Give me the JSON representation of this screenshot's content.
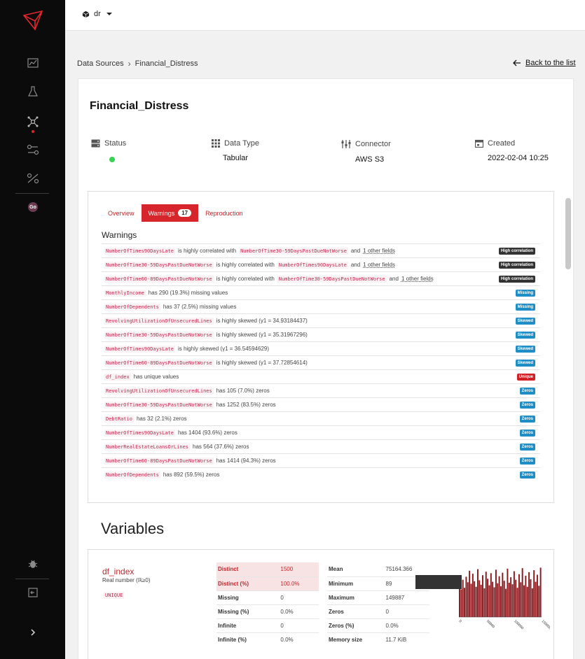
{
  "topbar": {
    "project": "dr"
  },
  "breadcrumb": {
    "parent": "Data Sources",
    "current": "Financial_Distress",
    "back": "Back to the list"
  },
  "dataset": {
    "title": "Financial_Distress",
    "meta": [
      {
        "label": "Status",
        "value": "",
        "icon": "server-icon"
      },
      {
        "label": "Data Type",
        "value": "Tabular",
        "icon": "grid-icon"
      },
      {
        "label": "Connector",
        "value": "AWS S3",
        "icon": "connector-icon"
      },
      {
        "label": "Created",
        "value": "2022-02-04 10:25",
        "icon": "calendar-icon"
      }
    ],
    "status_color": "#39d353"
  },
  "report": {
    "tabs": [
      {
        "label": "Overview"
      },
      {
        "label": "Warnings",
        "count": "17"
      },
      {
        "label": "Reproduction"
      }
    ],
    "warnings_heading": "Warnings",
    "warnings": [
      {
        "field": "NumberOfTimes90DaysLate",
        "text": "is highly correlated with",
        "field2": "NumberOfTime30-59DaysPastDueNotWorse",
        "tail": "and",
        "link": "1 other fields",
        "badge": "High correlation",
        "kind": "corr"
      },
      {
        "field": "NumberOfTime30-59DaysPastDueNotWorse",
        "text": "is highly correlated with",
        "field2": "NumberOfTimes90DaysLate",
        "tail": "and",
        "link": "1 other fields",
        "badge": "High correlation",
        "kind": "corr"
      },
      {
        "field": "NumberOfTime60-89DaysPastDueNotWorse",
        "text": "is highly correlated with",
        "field2": "NumberOfTime30-59DaysPastDueNotWorse",
        "tail": "and",
        "link": "1 other fields",
        "badge": "High correlation",
        "kind": "corr"
      },
      {
        "field": "MonthlyIncome",
        "text": "has 290 (19.3%) missing values",
        "badge": "Missing",
        "kind": "miss"
      },
      {
        "field": "NumberOfDependents",
        "text": "has 37 (2.5%) missing values",
        "badge": "Missing",
        "kind": "miss"
      },
      {
        "field": "RevolvingUtilizationOfUnsecuredLines",
        "text": "is highly skewed (γ1 = 34.93184437)",
        "badge": "Skewed",
        "kind": "skew"
      },
      {
        "field": "NumberOfTime30-59DaysPastDueNotWorse",
        "text": "is highly skewed (γ1 = 35.31967296)",
        "badge": "Skewed",
        "kind": "skew"
      },
      {
        "field": "NumberOfTimes90DaysLate",
        "text": "is highly skewed (γ1 = 36.54594629)",
        "badge": "Skewed",
        "kind": "skew"
      },
      {
        "field": "NumberOfTime60-89DaysPastDueNotWorse",
        "text": "is highly skewed (γ1 = 37.72854614)",
        "badge": "Skewed",
        "kind": "skew"
      },
      {
        "field": "df_index",
        "text": "has unique values",
        "badge": "Unique",
        "kind": "uniq"
      },
      {
        "field": "RevolvingUtilizationOfUnsecuredLines",
        "text": "has 105 (7.0%) zeros",
        "badge": "Zeros",
        "kind": "zero"
      },
      {
        "field": "NumberOfTime30-59DaysPastDueNotWorse",
        "text": "has 1252 (83.5%) zeros",
        "badge": "Zeros",
        "kind": "zero"
      },
      {
        "field": "DebtRatio",
        "text": "has 32 (2.1%) zeros",
        "badge": "Zeros",
        "kind": "zero"
      },
      {
        "field": "NumberOfTimes90DaysLate",
        "text": "has 1404 (93.6%) zeros",
        "badge": "Zeros",
        "kind": "zero"
      },
      {
        "field": "NumberRealEstateLoansOrLines",
        "text": "has 564 (37.6%) zeros",
        "badge": "Zeros",
        "kind": "zero"
      },
      {
        "field": "NumberOfTime60-89DaysPastDueNotWorse",
        "text": "has 1414 (94.3%) zeros",
        "badge": "Zeros",
        "kind": "zero"
      },
      {
        "field": "NumberOfDependents",
        "text": "has 892 (59.5%) zeros",
        "badge": "Zeros",
        "kind": "zero"
      }
    ]
  },
  "variables": {
    "heading": "Variables",
    "items": [
      {
        "name": "df_index",
        "type": "Real number (ℝ≥0)",
        "tag": "UNIQUE",
        "stats_left": [
          {
            "k": "Distinct",
            "v": "1500",
            "alert": true
          },
          {
            "k": "Distinct (%)",
            "v": "100.0%",
            "alert": true
          },
          {
            "k": "Missing",
            "v": "0"
          },
          {
            "k": "Missing (%)",
            "v": "0.0%"
          },
          {
            "k": "Infinite",
            "v": "0"
          },
          {
            "k": "Infinite (%)",
            "v": "0.0%"
          }
        ],
        "stats_right": [
          {
            "k": "Mean",
            "v": "75164.366"
          },
          {
            "k": "Minimum",
            "v": "89"
          },
          {
            "k": "Maximum",
            "v": "149887"
          },
          {
            "k": "Zeros",
            "v": "0"
          },
          {
            "k": "Zeros (%)",
            "v": "0.0%"
          },
          {
            "k": "Memory size",
            "v": "11.7 KiB"
          }
        ],
        "histogram": {
          "x_ticks": [
            "0",
            "50000",
            "100000",
            "150000"
          ],
          "values": [
            0.62,
            0.55,
            0.74,
            0.58,
            0.8,
            0.69,
            0.92,
            0.66,
            0.86,
            0.71,
            0.6,
            0.95,
            0.73,
            0.64,
            0.83,
            0.57,
            0.9,
            0.76,
            0.63,
            0.87,
            0.7,
            0.59,
            0.94,
            0.67,
            0.81,
            0.61,
            0.88,
            0.72,
            0.56,
            0.96,
            0.68,
            0.79,
            0.65,
            0.91,
            0.74,
            0.58,
            0.85,
            0.69,
            0.97,
            0.63,
            0.82,
            0.6,
            0.89,
            0.75,
            0.57,
            0.93,
            0.7,
            0.84,
            0.62,
            0.98
          ],
          "bar_color": "#8b1a1f"
        }
      }
    ]
  }
}
